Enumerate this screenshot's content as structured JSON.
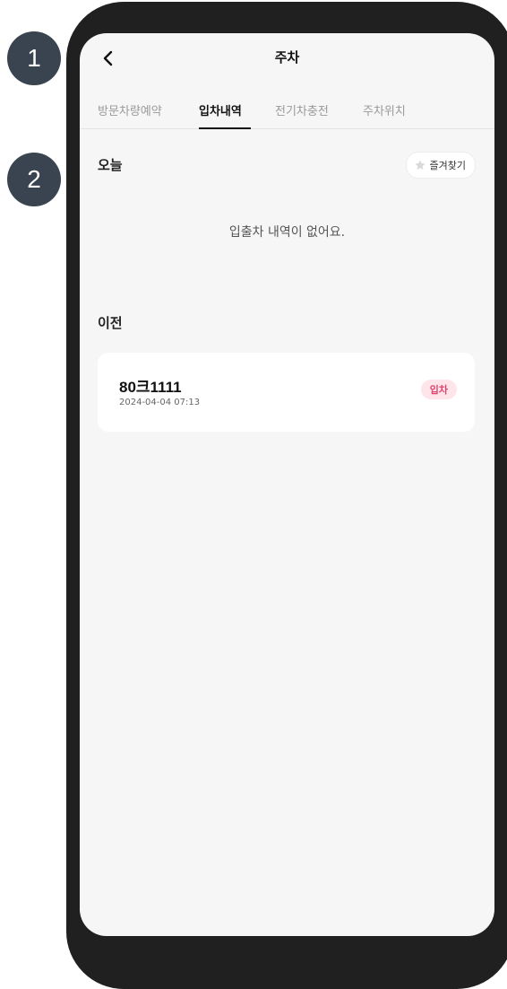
{
  "annotations": [
    "1",
    "2"
  ],
  "header": {
    "title": "주차"
  },
  "tabs": [
    {
      "label": "방문차량예약",
      "active": false
    },
    {
      "label": "입차내역",
      "active": true
    },
    {
      "label": "전기차충전",
      "active": false
    },
    {
      "label": "주차위치",
      "active": false
    }
  ],
  "today": {
    "label": "오늘",
    "favorite_label": "즐겨찾기",
    "empty_message": "입출차 내역이 없어요."
  },
  "previous": {
    "label": "이전",
    "entries": [
      {
        "plate": "80크1111",
        "datetime": "2024-04-04 07:13",
        "status": "입차"
      }
    ]
  },
  "colors": {
    "badge": "#3a4450",
    "status_text": "#e0456b",
    "status_bg": "#fde5ea"
  }
}
